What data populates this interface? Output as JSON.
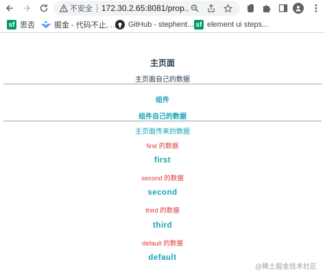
{
  "browser": {
    "security_label": "不安全",
    "url": "172.30.2.65:8081/prop...",
    "bookmarks": [
      {
        "icon": "sf",
        "label": "思否"
      },
      {
        "icon": "juejin",
        "label": "掘金 - 代码不止, ..."
      },
      {
        "icon": "github",
        "label": "GitHub - stephent..."
      },
      {
        "icon": "sf",
        "label": "element ui steps..."
      }
    ]
  },
  "page": {
    "main_title": "主页面",
    "main_data": "主页面自己的数据",
    "component_title": "组件",
    "component_data": "组件自己的数据",
    "passed_title": "主页面传来的数据",
    "items": [
      {
        "label": "first 的数据",
        "value": "first"
      },
      {
        "label": "second 的数据",
        "value": "second"
      },
      {
        "label": "third 的数据",
        "value": "third"
      },
      {
        "label": "default 的数据",
        "value": "default"
      }
    ],
    "watermark": "@稀土掘金技术社区"
  },
  "colors": {
    "heading": "#2c3e50",
    "teal": "#17a2b8",
    "red": "#e03636"
  }
}
